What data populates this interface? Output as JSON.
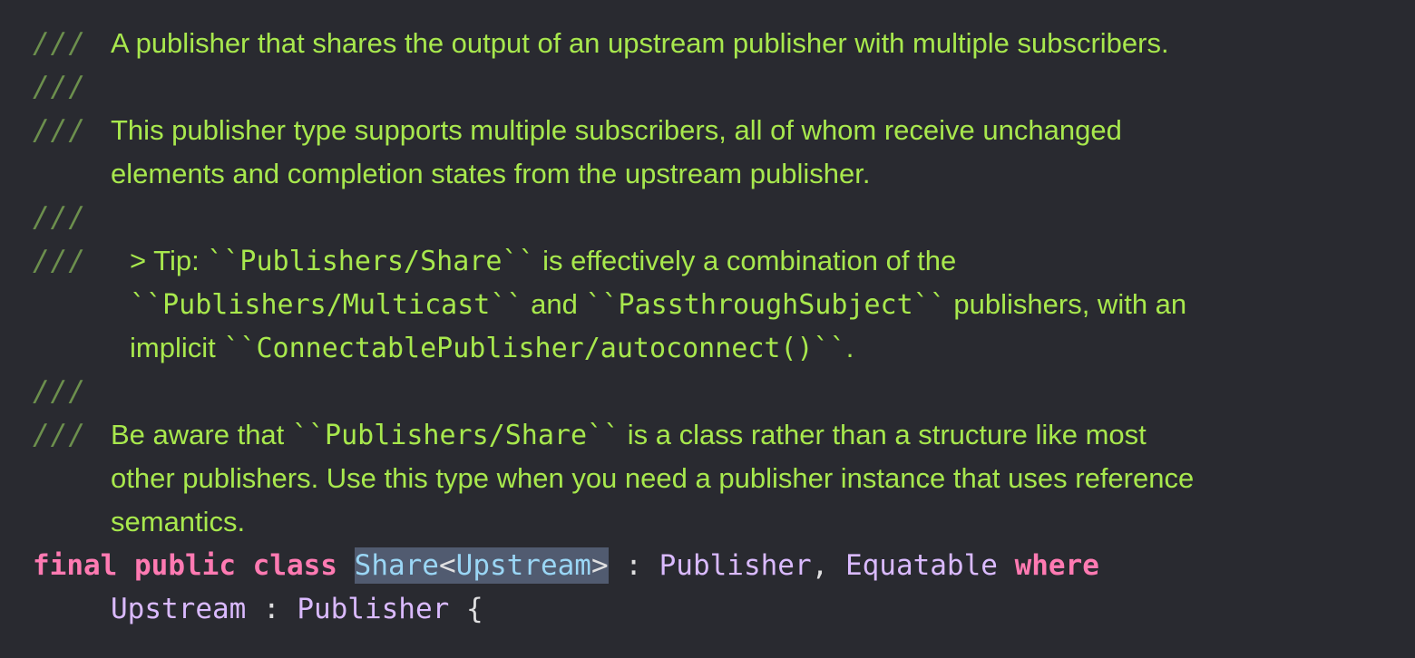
{
  "editor": {
    "comment_marker": "///",
    "lines": [
      {
        "text": "A publisher that shares the output of an upstream publisher with multiple subscribers."
      },
      {
        "text": ""
      },
      {
        "text": "This publisher type supports multiple subscribers, all of whom receive unchanged"
      },
      {
        "text": "elements and completion states from the upstream publisher."
      },
      {
        "text": ""
      },
      {
        "tip_prefix": "> Tip: ",
        "tip_code1": "``Publishers/Share``",
        "tip_rest1": " is effectively a combination of the"
      },
      {
        "tip_code2": "``Publishers/Multicast``",
        "tip_and": " and ",
        "tip_code3": "``PassthroughSubject``",
        "tip_rest2": " publishers, with an"
      },
      {
        "tip_implicit": "implicit ",
        "tip_code4": "``ConnectablePublisher/autoconnect()``",
        "tip_dot": "."
      },
      {
        "text": ""
      },
      {
        "aware_prefix": "Be aware that ",
        "aware_code": "``Publishers/Share``",
        "aware_rest": " is a class rather than a structure like most"
      },
      {
        "text": "other publishers. Use this type when you need a publisher instance that uses reference"
      },
      {
        "text": "semantics."
      }
    ],
    "declaration": {
      "kw_final": "final",
      "kw_public": "public",
      "kw_class": "class",
      "name": "Share",
      "lt": "<",
      "generic": "Upstream",
      "gt": ">",
      "colon1": " : ",
      "proto1": "Publisher",
      "comma": ", ",
      "proto2": "Equatable",
      "kw_where": "where",
      "cont_type": "Upstream",
      "colon2": " : ",
      "cont_proto": "Publisher",
      "brace": " {"
    },
    "colors": {
      "background": "#292a30",
      "doc_comment": "#a8e84d",
      "comment_slashes": "#6c8f4d",
      "keyword": "#ff7ab2",
      "type": "#dabaff",
      "selected_type": "#9ad6f5",
      "selection": "#515b70"
    }
  }
}
